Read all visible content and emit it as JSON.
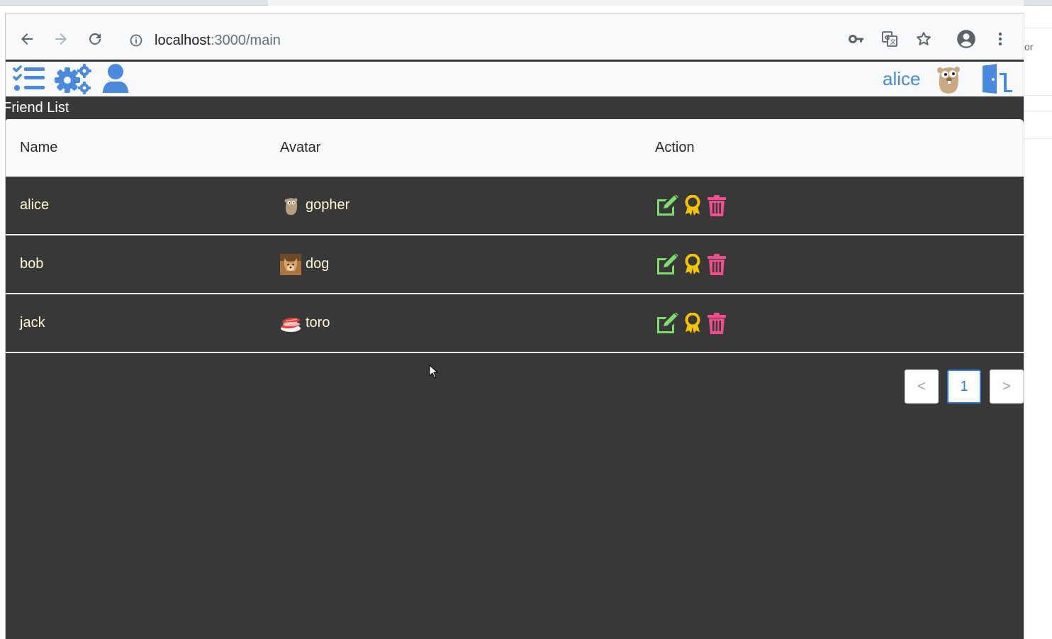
{
  "browser": {
    "url_host": "localhost",
    "url_path": ":3000/main",
    "side_window_text": "or"
  },
  "navbar": {
    "icons": [
      "task-list-icon",
      "gears-icon",
      "user-icon"
    ],
    "username": "alice",
    "avatar": "gopher-avatar",
    "logout_icon": "door-exit-icon"
  },
  "section": {
    "title": "Friend List"
  },
  "table": {
    "headers": [
      "Name",
      "Avatar",
      "Action"
    ],
    "rows": [
      {
        "name": "alice",
        "avatar": "gopher",
        "avatar_icon": "gopher-avatar"
      },
      {
        "name": "bob",
        "avatar": "dog",
        "avatar_icon": "dog-avatar"
      },
      {
        "name": "jack",
        "avatar": "toro",
        "avatar_icon": "sushi-avatar"
      }
    ],
    "actions": [
      "edit-icon",
      "award-icon",
      "trash-icon"
    ]
  },
  "pagination": {
    "prev": "<",
    "current": "1",
    "next": ">"
  },
  "colors": {
    "accent": "#4a89dc",
    "edit": "#7ddf6a",
    "award": "#f5c400",
    "delete": "#f24d8c",
    "row_text": "#fff7d6",
    "background": "#383838"
  }
}
